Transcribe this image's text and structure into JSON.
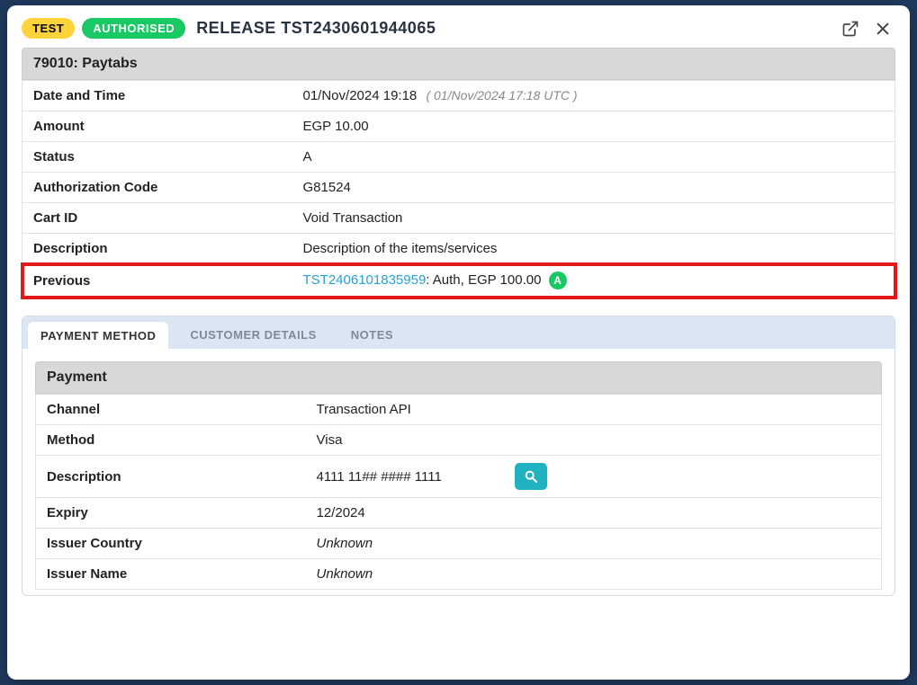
{
  "header": {
    "badge_test": "TEST",
    "badge_authorised": "AUTHORISED",
    "title": "RELEASE  TST2430601944065"
  },
  "section_title": "79010: Paytabs",
  "details": {
    "date_time_label": "Date and Time",
    "date_time_value": "01/Nov/2024 19:18",
    "date_time_utc": "( 01/Nov/2024 17:18 UTC )",
    "amount_label": "Amount",
    "amount_value": "EGP 10.00",
    "status_label": "Status",
    "status_value": "A",
    "auth_code_label": "Authorization Code",
    "auth_code_value": "G81524",
    "cart_id_label": "Cart ID",
    "cart_id_value": "Void Transaction",
    "description_label": "Description",
    "description_value": "Description of the items/services",
    "previous_label": "Previous",
    "previous_link": "TST2406101835959",
    "previous_rest": ": Auth, EGP 100.00",
    "previous_pill": "A"
  },
  "tabs": {
    "payment_method": "PAYMENT METHOD",
    "customer_details": "CUSTOMER DETAILS",
    "notes": "NOTES"
  },
  "payment": {
    "section_title": "Payment",
    "channel_label": "Channel",
    "channel_value": "Transaction API",
    "method_label": "Method",
    "method_value": "Visa",
    "description_label": "Description",
    "description_value": "4111 11## #### 1111",
    "expiry_label": "Expiry",
    "expiry_value": "12/2024",
    "issuer_country_label": "Issuer Country",
    "issuer_country_value": "Unknown",
    "issuer_name_label": "Issuer Name",
    "issuer_name_value": "Unknown"
  }
}
